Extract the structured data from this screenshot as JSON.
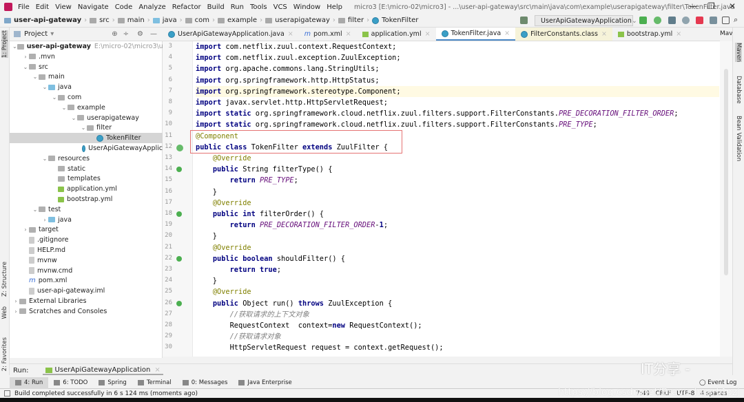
{
  "menubar": {
    "items": [
      "File",
      "Edit",
      "View",
      "Navigate",
      "Code",
      "Analyze",
      "Refactor",
      "Build",
      "Run",
      "Tools",
      "VCS",
      "Window",
      "Help"
    ],
    "title": "micro3 [E:\\micro-02\\micro3] - ...\\user-api-gateway\\src\\main\\java\\com\\example\\userapigateway\\filter\\TokenFilter.java"
  },
  "breadcrumb": [
    "user-api-gateway",
    "src",
    "main",
    "java",
    "com",
    "example",
    "userapigateway",
    "filter",
    "TokenFilter"
  ],
  "run_config": "UserApiGatewayApplication",
  "project_panel": {
    "title": "Project"
  },
  "tree": [
    {
      "label": "user-api-gateway",
      "path": "E:\\micro-02\\micro3\\user-ap",
      "level": 0,
      "arrow": "down",
      "icon": "module"
    },
    {
      "label": ".mvn",
      "level": 1,
      "arrow": "right",
      "icon": "folder"
    },
    {
      "label": "src",
      "level": 1,
      "arrow": "down",
      "icon": "folder"
    },
    {
      "label": "main",
      "level": 2,
      "arrow": "down",
      "icon": "folder"
    },
    {
      "label": "java",
      "level": 3,
      "arrow": "down",
      "icon": "src"
    },
    {
      "label": "com",
      "level": 4,
      "arrow": "down",
      "icon": "folder"
    },
    {
      "label": "example",
      "level": 5,
      "arrow": "down",
      "icon": "folder"
    },
    {
      "label": "userapigateway",
      "level": 6,
      "arrow": "down",
      "icon": "folder"
    },
    {
      "label": "filter",
      "level": 7,
      "arrow": "down",
      "icon": "folder"
    },
    {
      "label": "TokenFilter",
      "level": 8,
      "arrow": "",
      "icon": "class",
      "selected": true
    },
    {
      "label": "UserApiGatewayApplic",
      "level": 7,
      "arrow": "",
      "icon": "class"
    },
    {
      "label": "resources",
      "level": 3,
      "arrow": "down",
      "icon": "folder"
    },
    {
      "label": "static",
      "level": 4,
      "arrow": "",
      "icon": "folder"
    },
    {
      "label": "templates",
      "level": 4,
      "arrow": "",
      "icon": "folder"
    },
    {
      "label": "application.yml",
      "level": 4,
      "arrow": "",
      "icon": "yml"
    },
    {
      "label": "bootstrap.yml",
      "level": 4,
      "arrow": "",
      "icon": "yml"
    },
    {
      "label": "test",
      "level": 2,
      "arrow": "down",
      "icon": "folder"
    },
    {
      "label": "java",
      "level": 3,
      "arrow": "right",
      "icon": "src"
    },
    {
      "label": "target",
      "level": 1,
      "arrow": "right",
      "icon": "folder"
    },
    {
      "label": ".gitignore",
      "level": 1,
      "arrow": "",
      "icon": "file"
    },
    {
      "label": "HELP.md",
      "level": 1,
      "arrow": "",
      "icon": "file"
    },
    {
      "label": "mvnw",
      "level": 1,
      "arrow": "",
      "icon": "file"
    },
    {
      "label": "mvnw.cmd",
      "level": 1,
      "arrow": "",
      "icon": "file"
    },
    {
      "label": "pom.xml",
      "level": 1,
      "arrow": "",
      "icon": "pom"
    },
    {
      "label": "user-api-gateway.iml",
      "level": 1,
      "arrow": "",
      "icon": "file"
    },
    {
      "label": "External Libraries",
      "level": 0,
      "arrow": "right",
      "icon": "libs"
    },
    {
      "label": "Scratches and Consoles",
      "level": 0,
      "arrow": "right",
      "icon": "scratch"
    }
  ],
  "tabs": [
    {
      "label": "UserApiGatewayApplication.java",
      "kind": "class"
    },
    {
      "label": "pom.xml",
      "kind": "pom"
    },
    {
      "label": "application.yml",
      "kind": "yml"
    },
    {
      "label": "TokenFilter.java",
      "kind": "class",
      "active": true
    },
    {
      "label": "FilterConstants.class",
      "kind": "class-file"
    },
    {
      "label": "bootstrap.yml",
      "kind": "yml"
    }
  ],
  "left_strip": [
    "1: Project",
    "Z: Structure",
    "Web",
    "2: Favorites"
  ],
  "right_strip": {
    "head": "Mav",
    "items": [
      "Maven",
      "Database",
      "Bean Validation"
    ]
  },
  "code": [
    {
      "n": "3",
      "segs": [
        [
          "kw",
          "import "
        ],
        [
          "",
          "com.netflix.zuul.context.RequestContext;"
        ]
      ]
    },
    {
      "n": "4",
      "segs": [
        [
          "kw",
          "import "
        ],
        [
          "",
          "com.netflix.zuul.exception.ZuulException;"
        ]
      ]
    },
    {
      "n": "5",
      "segs": [
        [
          "kw",
          "import "
        ],
        [
          "",
          "org.apache.commons.lang.StringUtils;"
        ]
      ]
    },
    {
      "n": "6",
      "segs": [
        [
          "kw",
          "import "
        ],
        [
          "",
          "org.springframework.http.HttpStatus;"
        ]
      ]
    },
    {
      "n": "7",
      "segs": [
        [
          "kw",
          "import "
        ],
        [
          "",
          "org.springframework.stereotype.Component;"
        ]
      ],
      "hl": true
    },
    {
      "n": "8",
      "segs": [
        [
          "kw",
          "import "
        ],
        [
          "",
          "javax.servlet.http.HttpServletRequest;"
        ]
      ]
    },
    {
      "n": "9",
      "segs": [
        [
          "kw",
          "import static "
        ],
        [
          "",
          "org.springframework.cloud.netflix.zuul.filters.support.FilterConstants."
        ],
        [
          "st",
          "PRE_DECORATION_FILTER_ORDER"
        ],
        [
          "",
          ";"
        ]
      ]
    },
    {
      "n": "10",
      "segs": [
        [
          "kw",
          "import static "
        ],
        [
          "",
          "org.springframework.cloud.netflix.zuul.filters.support.FilterConstants."
        ],
        [
          "st",
          "PRE_TYPE"
        ],
        [
          "",
          ";"
        ]
      ]
    },
    {
      "n": "11",
      "segs": [
        [
          "ann",
          "@Component"
        ]
      ]
    },
    {
      "n": "12",
      "segs": [
        [
          "kw",
          "public class "
        ],
        [
          "",
          "TokenFilter "
        ],
        [
          "kw",
          "extends "
        ],
        [
          "",
          "ZuulFilter {"
        ]
      ],
      "icon": "bean"
    },
    {
      "n": "13",
      "segs": [
        [
          "",
          "    "
        ],
        [
          "ann",
          "@Override"
        ]
      ]
    },
    {
      "n": "14",
      "segs": [
        [
          "",
          "    "
        ],
        [
          "kw",
          "public "
        ],
        [
          "",
          "String filterType() {"
        ]
      ],
      "icon": "override"
    },
    {
      "n": "15",
      "segs": [
        [
          "",
          "        "
        ],
        [
          "kw",
          "return "
        ],
        [
          "st",
          "PRE_TYPE"
        ],
        [
          "",
          ";"
        ]
      ]
    },
    {
      "n": "16",
      "segs": [
        [
          "",
          "    }"
        ]
      ]
    },
    {
      "n": "17",
      "segs": [
        [
          "",
          "    "
        ],
        [
          "ann",
          "@Override"
        ]
      ]
    },
    {
      "n": "18",
      "segs": [
        [
          "",
          "    "
        ],
        [
          "kw",
          "public int "
        ],
        [
          "",
          "filterOrder() {"
        ]
      ],
      "icon": "override"
    },
    {
      "n": "19",
      "segs": [
        [
          "",
          "        "
        ],
        [
          "kw",
          "return "
        ],
        [
          "st",
          "PRE_DECORATION_FILTER_ORDER"
        ],
        [
          "",
          "-"
        ],
        [
          "kw",
          "1"
        ],
        [
          "",
          ";"
        ]
      ]
    },
    {
      "n": "20",
      "segs": [
        [
          "",
          "    }"
        ]
      ]
    },
    {
      "n": "21",
      "segs": [
        [
          "",
          "    "
        ],
        [
          "ann",
          "@Override"
        ]
      ]
    },
    {
      "n": "22",
      "segs": [
        [
          "",
          "    "
        ],
        [
          "kw",
          "public boolean "
        ],
        [
          "",
          "shouldFilter() {"
        ]
      ],
      "icon": "override"
    },
    {
      "n": "23",
      "segs": [
        [
          "",
          "        "
        ],
        [
          "kw",
          "return true"
        ],
        [
          "",
          ";"
        ]
      ]
    },
    {
      "n": "24",
      "segs": [
        [
          "",
          "    }"
        ]
      ]
    },
    {
      "n": "25",
      "segs": [
        [
          "",
          "    "
        ],
        [
          "ann",
          "@Override"
        ]
      ]
    },
    {
      "n": "26",
      "segs": [
        [
          "",
          "    "
        ],
        [
          "kw",
          "public "
        ],
        [
          "",
          "Object run() "
        ],
        [
          "kw",
          "throws "
        ],
        [
          "",
          "ZuulException {"
        ]
      ],
      "icon": "override"
    },
    {
      "n": "27",
      "segs": [
        [
          "",
          "        "
        ],
        [
          "cm",
          "//获取请求的上下文对象"
        ]
      ]
    },
    {
      "n": "28",
      "segs": [
        [
          "",
          "        RequestContext  context="
        ],
        [
          "kw",
          "new "
        ],
        [
          "",
          "RequestContext();"
        ]
      ]
    },
    {
      "n": "29",
      "segs": [
        [
          "",
          "        "
        ],
        [
          "cm",
          "//获取请求对象"
        ]
      ]
    },
    {
      "n": "30",
      "segs": [
        [
          "",
          "        HttpServletRequest request = context.getRequest();"
        ]
      ]
    }
  ],
  "run_bar": {
    "label": "Run:",
    "tab": "UserApiGatewayApplication"
  },
  "tool_tabs": [
    {
      "label": "4: Run",
      "active": true
    },
    {
      "label": "6: TODO"
    },
    {
      "label": "Spring"
    },
    {
      "label": "Terminal"
    },
    {
      "label": "0: Messages"
    },
    {
      "label": "Java Enterprise"
    }
  ],
  "event_log": "Event Log",
  "status": {
    "message": "Build completed successfully in 6 s 124 ms (moments ago)",
    "position": "7:49",
    "line_sep": "CRLF",
    "encoding": "UTF-8",
    "indent": "4 spaces"
  },
  "watermark": {
    "text": "IT分享 -",
    "url": "https://blog.csdn.net/Brave_heart4pzj"
  },
  "colors": {
    "keyword": "#000080",
    "annotation": "#808000",
    "static": "#660e7a",
    "comment": "#808080",
    "highlight_box": "#e57373",
    "selected_row": "#d5d5d5",
    "active_tab_underline": "#4a88c7"
  }
}
